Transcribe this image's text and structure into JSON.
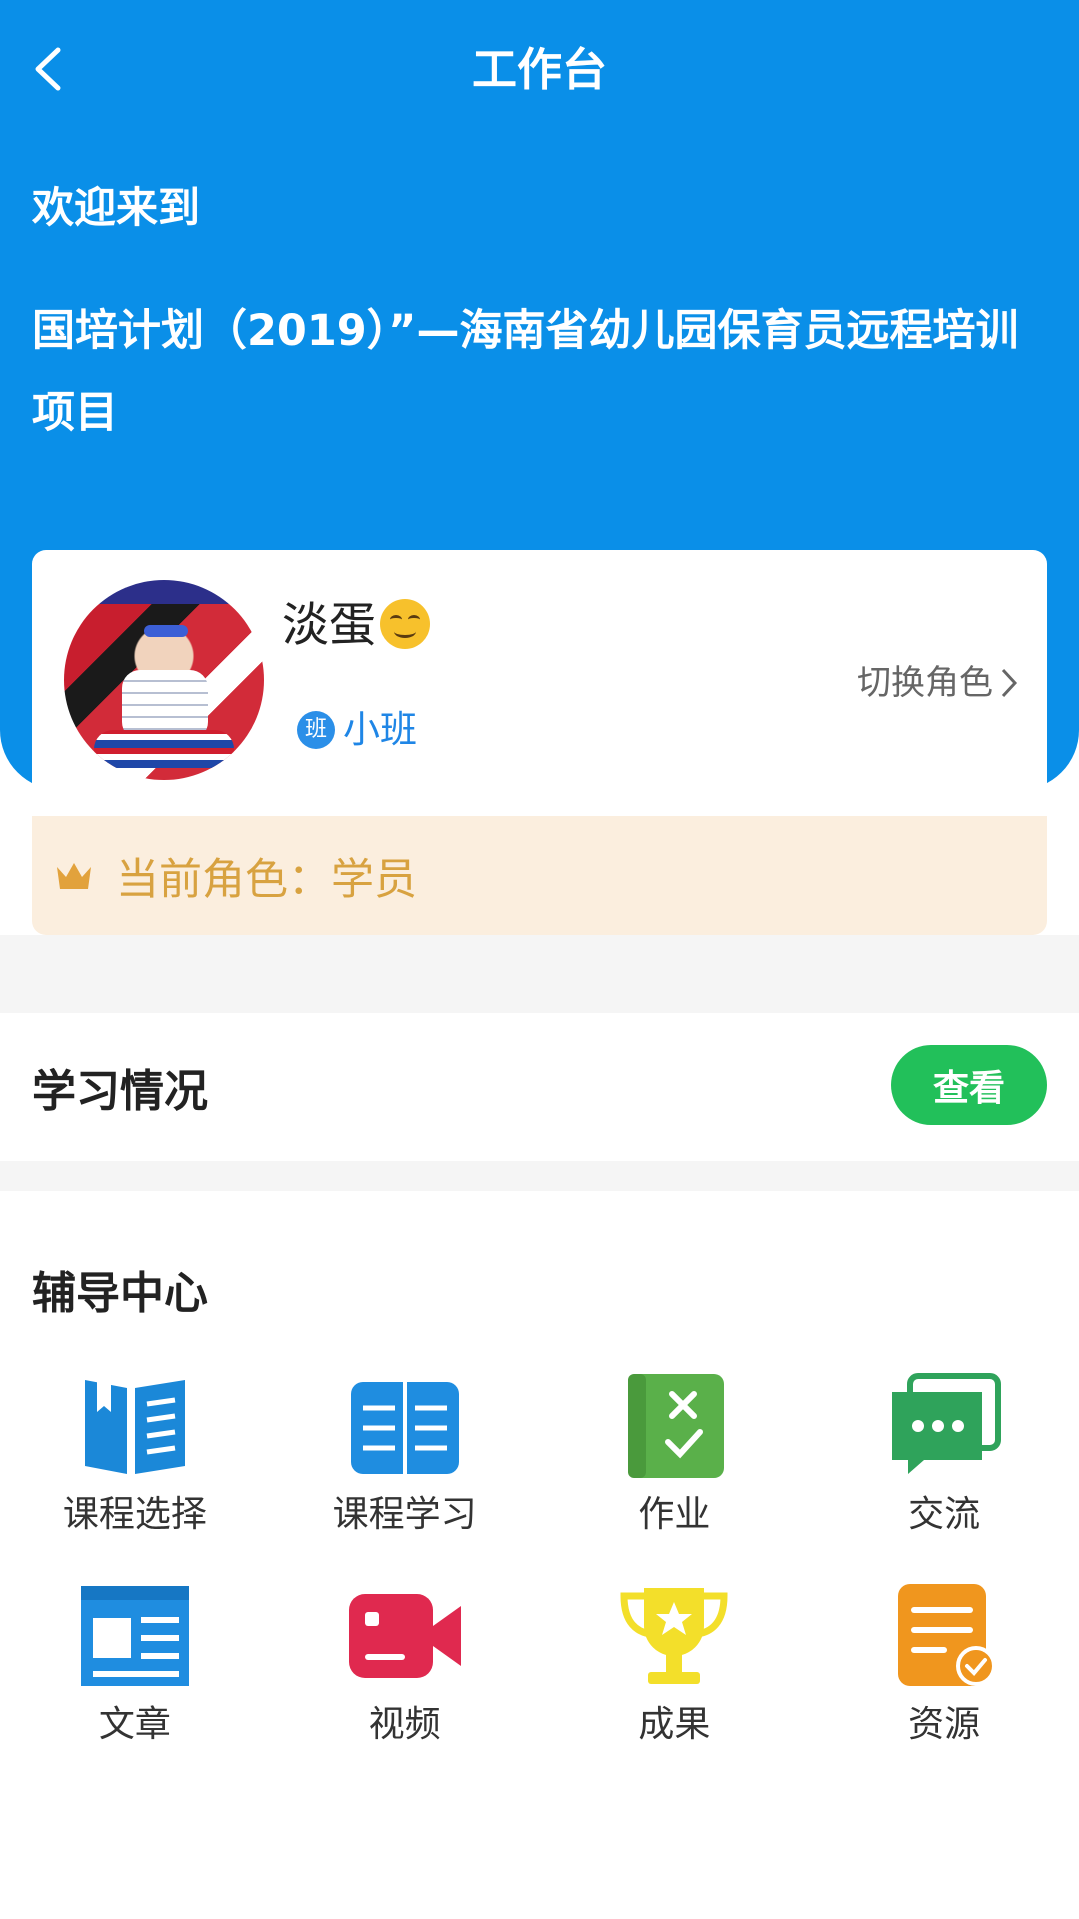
{
  "header": {
    "title": "工作台",
    "welcome": "欢迎来到",
    "project": "国培计划（2019）”—海南省幼儿园保育员远程培训项目"
  },
  "profile": {
    "name": "淡蛋",
    "class_name": "小班",
    "switch_label": "切换角色",
    "current_role": "当前角色：学员"
  },
  "study": {
    "title": "学习情况",
    "button": "查看"
  },
  "tutoring": {
    "title": "辅导中心",
    "items": [
      {
        "label": "课程选择",
        "icon": "course-select-icon",
        "color": "#1b88d8"
      },
      {
        "label": "课程学习",
        "icon": "course-study-icon",
        "color": "#1f8de0"
      },
      {
        "label": "作业",
        "icon": "homework-icon",
        "color": "#5ab04a"
      },
      {
        "label": "交流",
        "icon": "chat-icon",
        "color": "#2fa35b"
      },
      {
        "label": "文章",
        "icon": "article-icon",
        "color": "#1f8de0"
      },
      {
        "label": "视频",
        "icon": "video-icon",
        "color": "#e0294f"
      },
      {
        "label": "成果",
        "icon": "trophy-icon",
        "color": "#f3df2a"
      },
      {
        "label": "资源",
        "icon": "resource-icon",
        "color": "#f0961e"
      }
    ]
  },
  "colors": {
    "header_bg": "#0a8fe8",
    "view_button": "#22c05a",
    "role_bar_bg": "#fbeede",
    "role_text": "#d8a240"
  }
}
